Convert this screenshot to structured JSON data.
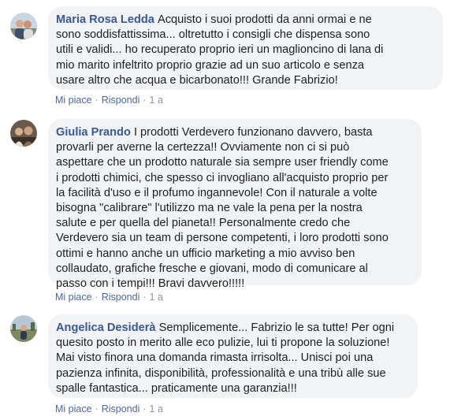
{
  "comments": [
    {
      "author": "Maria Rosa Ledda",
      "lines": [
        "Acquisto i suoi prodotti da anni ormai e ne",
        "sono soddisfattissima... oltretutto i consigli che dispensa sono",
        "utili e validi... ho recuperato proprio ieri un maglioncino di lana di",
        "mio marito infeltrito proprio grazie ad un suo articolo e senza",
        "usare altro che acqua e bicarbonato!!! Grande Fabrizio!"
      ],
      "like_label": "Mi piace",
      "reply_label": "Rispondi",
      "time": "1 a"
    },
    {
      "author": "Giulia Prando",
      "lines": [
        "I prodotti Verdevero funzionano davvero, basta",
        "provarli per averne la certezza!! Ovviamente non ci si può",
        "aspettare che un prodotto naturale sia sempre user friendly come",
        "i prodotti chimici, che spesso ci invogliano all'acquisto proprio per",
        "la facilità d'uso e il profumo ingannevole! Con il naturale a volte",
        "bisogna \"calibrare\" l'utilizzo ma ne vale la pena per la nostra",
        "salute e per quella del pianeta!! Personalmente credo che",
        "Verdevero sia un team di persone competenti, i loro prodotti sono",
        "ottimi e hanno anche un ufficio marketing a mio avviso ben",
        "collaudato, grafiche fresche e giovani, modo di comunicare al",
        "passo con i tempi!!! Bravi davvero!!!!!"
      ],
      "like_label": "Mi piace",
      "reply_label": "Rispondi",
      "time": "1 a"
    },
    {
      "author": "Angelica Desiderà",
      "lines": [
        "Semplicemente... Fabrizio le sa tutte! Per ogni",
        "quesito posto in merito alle eco pulizie, lui ti propone la soluzione!",
        "Mai visto finora una domanda rimasta irrisolta... Unisci poi una",
        "pazienza infinita, disponibilità, professionalità e una tribù alle sue",
        "spalle fantastica... praticamente una garanzia!!!"
      ],
      "like_label": "Mi piace",
      "reply_label": "Rispondi",
      "time": "1 a"
    }
  ],
  "colors": {
    "author": "#385898",
    "bubble_bg": "#f2f3f5",
    "text": "#1c1e21",
    "action_link": "#4b67a1",
    "meta": "#90949c"
  }
}
